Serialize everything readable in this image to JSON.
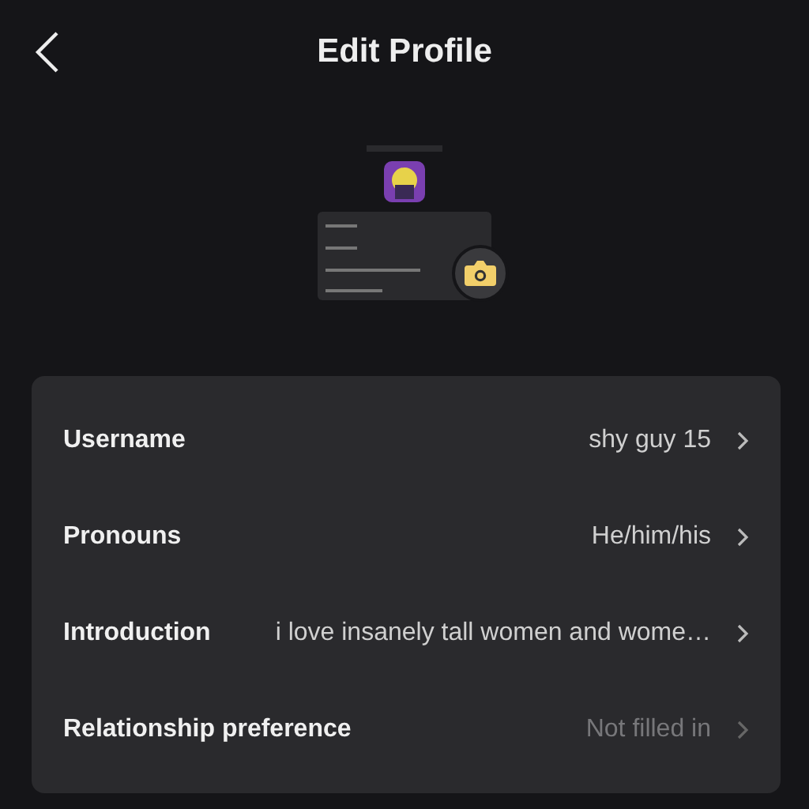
{
  "header": {
    "title": "Edit Profile"
  },
  "fields": [
    {
      "label": "Username",
      "value": "shy guy 15"
    },
    {
      "label": "Pronouns",
      "value": "He/him/his"
    },
    {
      "label": "Introduction",
      "value": "i love insanely tall women and wome…"
    },
    {
      "label": "Relationship preference",
      "placeholder": "Not filled in"
    }
  ]
}
